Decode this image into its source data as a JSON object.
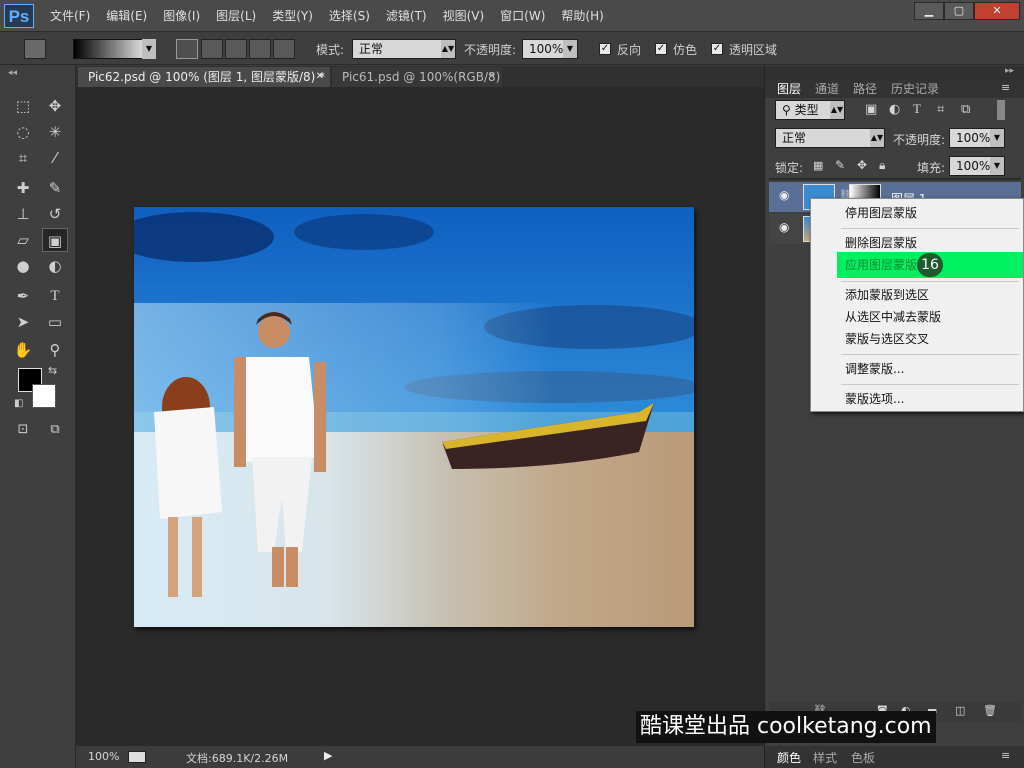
{
  "app": {
    "logo": "Ps"
  },
  "menu": [
    "文件(F)",
    "编辑(E)",
    "图像(I)",
    "图层(L)",
    "类型(Y)",
    "选择(S)",
    "滤镜(T)",
    "视图(V)",
    "窗口(W)",
    "帮助(H)"
  ],
  "options": {
    "mode_label": "模式:",
    "mode_value": "正常",
    "opacity_label": "不透明度:",
    "opacity_value": "100%",
    "reverse_label": "反向",
    "dither_label": "仿色",
    "transparency_label": "透明区域"
  },
  "tabs": [
    {
      "label": "Pic62.psd @ 100% (图层 1, 图层蒙版/8) *"
    },
    {
      "label": "Pic61.psd @ 100%(RGB/8)"
    }
  ],
  "status": {
    "zoom": "100%",
    "doc": "文档:689.1K/2.26M"
  },
  "layers_panel": {
    "tabs": [
      "图层",
      "通道",
      "路径",
      "历史记录"
    ],
    "filter_label": "类型",
    "blend_mode": "正常",
    "opacity_label": "不透明度:",
    "opacity_value": "100%",
    "lock_label": "锁定:",
    "fill_label": "填充:",
    "fill_value": "100%",
    "layer1_name": "图层 1"
  },
  "bottom_panel": {
    "tabs": [
      "颜色",
      "样式",
      "色板"
    ]
  },
  "context_menu": {
    "items": [
      "停用图层蒙版",
      "删除图层蒙版",
      "应用图层蒙版",
      "添加蒙版到选区",
      "从选区中减去蒙版",
      "蒙版与选区交叉",
      "调整蒙版...",
      "蒙版选项..."
    ],
    "highlight_index": 2,
    "step_badge": "16",
    "highlight_color": "#00f060"
  },
  "watermark": "酷课堂出品 coolketang.com"
}
